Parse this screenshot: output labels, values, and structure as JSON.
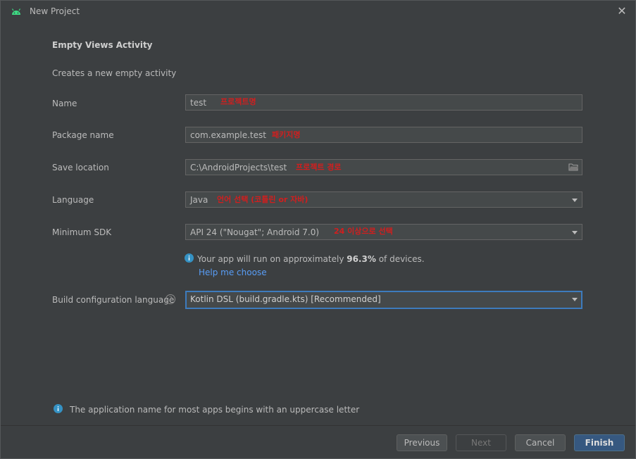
{
  "window": {
    "title": "New Project",
    "close_symbol": "✕"
  },
  "form": {
    "heading": "Empty Views Activity",
    "subheading": "Creates a new empty activity",
    "name": {
      "label": "Name",
      "value": "test",
      "annotation": "프로젝트명"
    },
    "package": {
      "label": "Package name",
      "value": "com.example.test",
      "annotation": "패키지명"
    },
    "save_location": {
      "label": "Save location",
      "value": "C:\\AndroidProjects\\test",
      "annotation": "프로젝트 경로"
    },
    "language": {
      "label": "Language",
      "value": "Java",
      "annotation": "언어 선택 (코틀린 or 자바)"
    },
    "min_sdk": {
      "label": "Minimum SDK",
      "value": "API 24 (\"Nougat\"; Android 7.0)",
      "annotation": "24 이상으로 선택"
    },
    "sdk_info": {
      "text_before": "Your app will run on approximately ",
      "percent": "96.3%",
      "text_after": " of devices.",
      "help_link": "Help me choose"
    },
    "build_config": {
      "label": "Build configuration language",
      "help_symbol": "?",
      "value": "Kotlin DSL (build.gradle.kts) [Recommended]"
    },
    "bottom_info": "The application name for most apps begins with an uppercase letter"
  },
  "buttons": {
    "previous": "Previous",
    "next": "Next",
    "cancel": "Cancel",
    "finish": "Finish"
  },
  "colors": {
    "background": "#3c3f41",
    "field": "#45494a",
    "focus": "#3d7bbd",
    "annotation": "#d21e1e",
    "link": "#589df6",
    "primary": "#365880"
  },
  "icons": [
    "android-icon",
    "close-icon",
    "folder-icon",
    "chevron-down-icon",
    "info-icon",
    "help-icon"
  ]
}
